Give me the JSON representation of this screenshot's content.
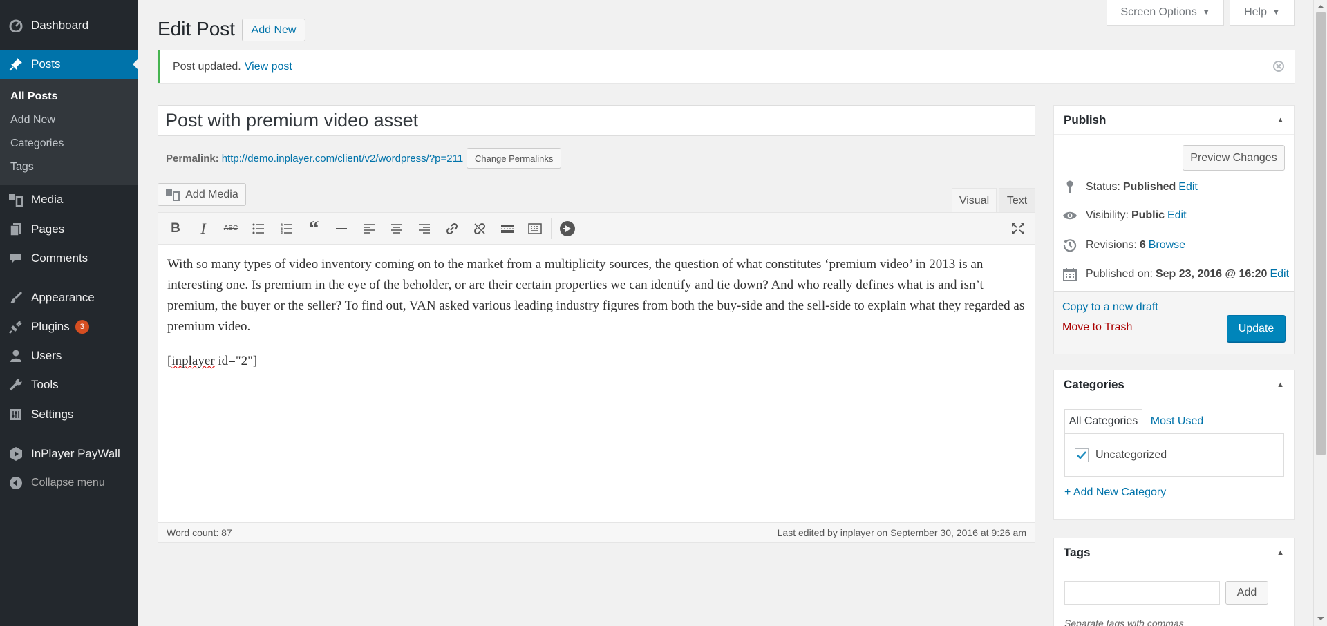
{
  "sidebar": {
    "dashboard": "Dashboard",
    "posts": "Posts",
    "submenu": [
      "All Posts",
      "Add New",
      "Categories",
      "Tags"
    ],
    "media": "Media",
    "pages": "Pages",
    "comments": "Comments",
    "appearance": "Appearance",
    "plugins": "Plugins",
    "plugins_badge": "3",
    "users": "Users",
    "tools": "Tools",
    "settings": "Settings",
    "inplayer": "InPlayer PayWall",
    "collapse": "Collapse menu"
  },
  "header": {
    "title": "Edit Post",
    "add_new": "Add New",
    "screen_options": "Screen Options",
    "help": "Help"
  },
  "notice": {
    "text": "Post updated.",
    "link": "View post"
  },
  "post": {
    "title": "Post with premium video asset",
    "permalink_label": "Permalink:",
    "permalink_url": "http://demo.inplayer.com/client/v2/wordpress/?p=211",
    "change_permalinks": "Change Permalinks"
  },
  "editor": {
    "add_media": "Add Media",
    "tab_visual": "Visual",
    "tab_text": "Text",
    "paragraph": "With so many types of video inventory coming on to the market from a multiplicity sources, the question of what constitutes ‘premium video’ in 2013 is an interesting one. Is premium in the eye of the beholder, or are their certain properties we can identify and tie down? And who really defines what is and isn’t premium, the buyer or the seller? To find out, VAN asked various leading industry figures from both the buy-side and the sell-side to explain what they regarded as premium video.",
    "shortcode_a": "inplayer",
    "shortcode_b": " id=\"2\"]",
    "shortcode_open": "[",
    "word_count": "Word count: 87",
    "last_edited": "Last edited by inplayer on September 30, 2016 at 9:26 am"
  },
  "publish": {
    "title": "Publish",
    "preview": "Preview Changes",
    "status_label": "Status:",
    "status_value": "Published",
    "visibility_label": "Visibility:",
    "visibility_value": "Public",
    "revisions_label": "Revisions:",
    "revisions_value": "6",
    "browse": "Browse",
    "published_label": "Published on:",
    "published_value": "Sep 23, 2016 @ 16:20",
    "edit": "Edit",
    "copy_draft": "Copy to a new draft",
    "trash": "Move to Trash",
    "update": "Update"
  },
  "categories": {
    "title": "Categories",
    "tab_all": "All Categories",
    "tab_used": "Most Used",
    "items": [
      {
        "label": "Uncategorized",
        "checked": true
      }
    ],
    "add_new": "+ Add New Category"
  },
  "tags": {
    "title": "Tags",
    "add": "Add",
    "hint": "Separate tags with commas"
  },
  "colors": {
    "sidebar_bg": "#23282d",
    "accent": "#0073aa",
    "primary_button": "#0085ba",
    "notice_success": "#46b450",
    "badge": "#d54e21"
  }
}
